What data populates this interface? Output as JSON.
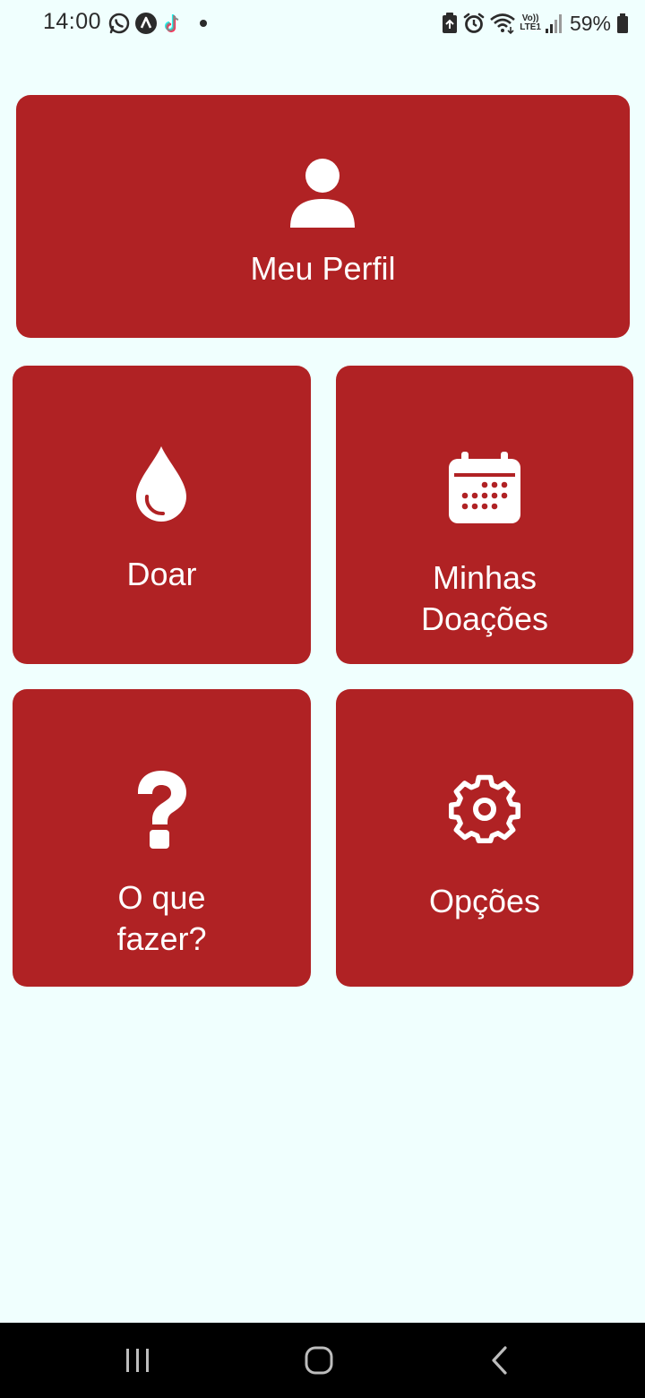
{
  "status_bar": {
    "time": "14:00",
    "battery_percent": "59%",
    "left_icons": [
      "whatsapp-icon",
      "vpn-icon",
      "tiktok-icon",
      "notification-dot-icon"
    ],
    "right_icons": [
      "battery-saver-icon",
      "alarm-icon",
      "wifi-icon",
      "volte-icon",
      "signal-icon",
      "battery-icon"
    ],
    "network_label_top": "Vo))",
    "network_label_bottom": "LTE1"
  },
  "menu": {
    "profile": {
      "label": "Meu Perfil",
      "icon": "person-icon"
    },
    "donate": {
      "label": "Doar",
      "icon": "blood-drop-icon"
    },
    "my_donations": {
      "label": "Minhas\nDoações",
      "icon": "calendar-icon"
    },
    "what_to_do": {
      "label": "O que\nfazer?",
      "icon": "question-mark-icon"
    },
    "options": {
      "label": "Opções",
      "icon": "gear-icon"
    }
  },
  "nav_bar": {
    "buttons": [
      "recent-apps-icon",
      "home-icon",
      "back-icon"
    ]
  },
  "colors": {
    "background": "#f0fffe",
    "tile": "#b02224",
    "tile_text": "#ffffff",
    "nav_bar": "#000000"
  }
}
